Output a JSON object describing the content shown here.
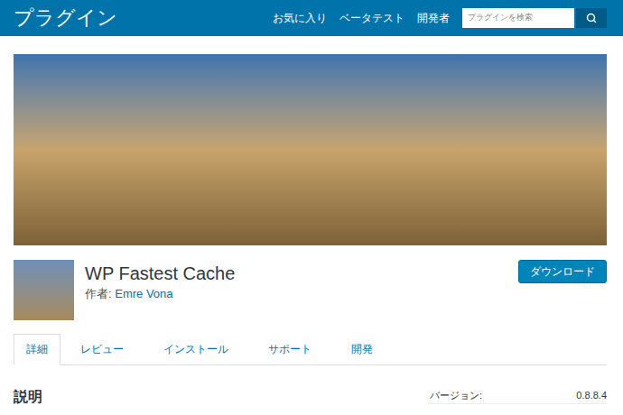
{
  "header": {
    "title": "プラグイン",
    "nav": [
      {
        "label": "お気に入り"
      },
      {
        "label": "ベータテスト"
      },
      {
        "label": "開発者"
      }
    ],
    "search": {
      "placeholder": "プラグインを検索"
    }
  },
  "plugin": {
    "name": "WP Fastest Cache",
    "author_label": "作者:",
    "author": "Emre Vona",
    "download": "ダウンロード"
  },
  "tabs": [
    {
      "label": "詳細",
      "selected": true
    },
    {
      "label": "レビュー",
      "selected": false
    },
    {
      "label": "インストール",
      "selected": false
    },
    {
      "label": "サポート",
      "selected": false
    },
    {
      "label": "開発",
      "selected": false
    }
  ],
  "description": {
    "heading": "説明"
  },
  "meta": [
    {
      "label": "バージョン:",
      "value": "0.8.8.4"
    }
  ]
}
